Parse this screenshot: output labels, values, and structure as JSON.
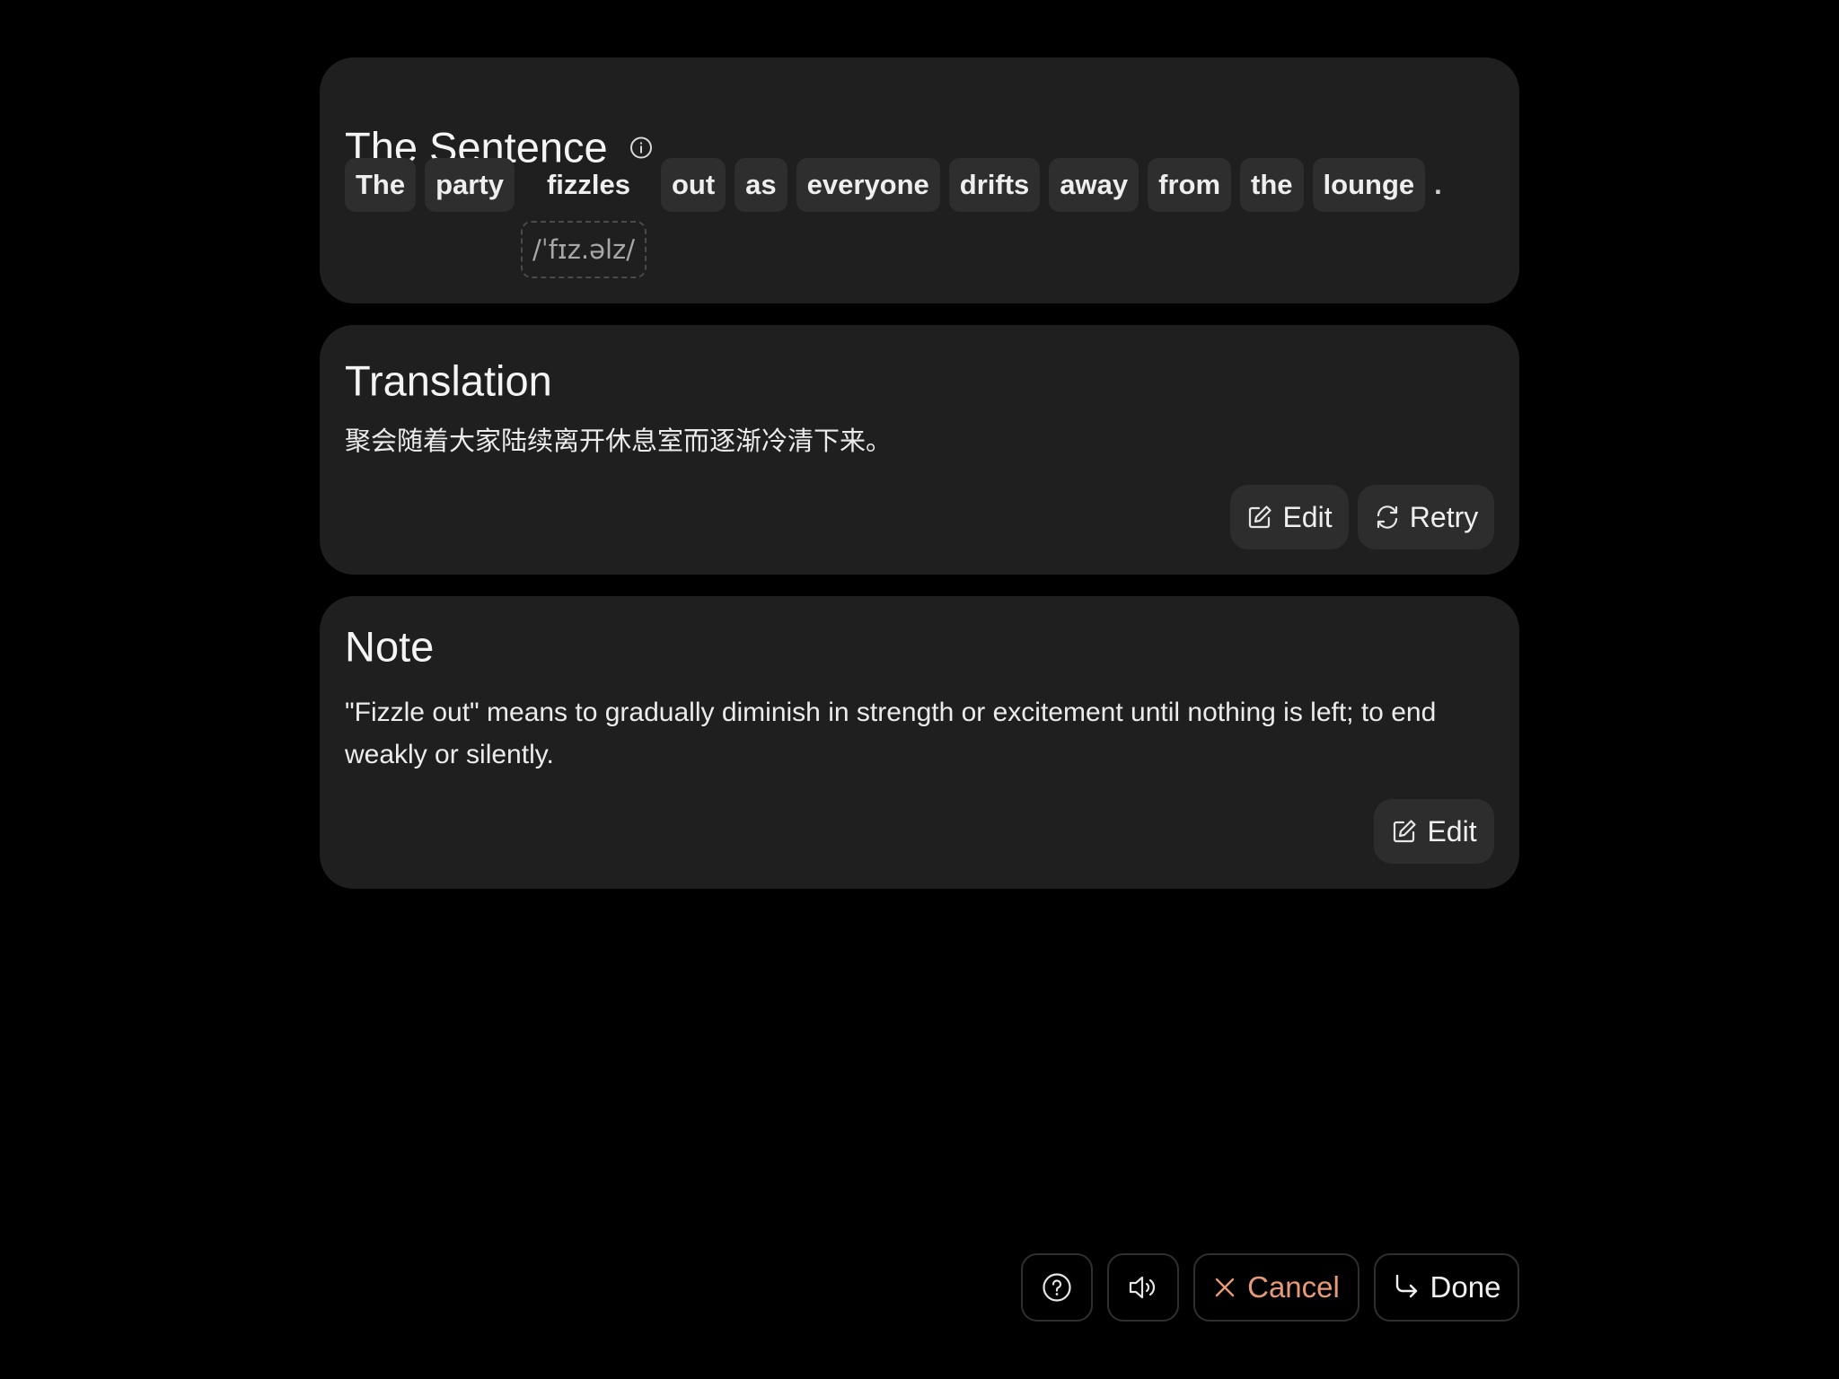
{
  "sentence_card": {
    "title": "The Sentence",
    "info_icon": "info-icon",
    "words": [
      "The",
      "party",
      "fizzles",
      "out",
      "as",
      "everyone",
      "drifts",
      "away",
      "from",
      "the",
      "lounge"
    ],
    "punctuation": ".",
    "selected_word": "fizzles",
    "phonetic": "/ˈfɪz.əlz/"
  },
  "translation_card": {
    "title": "Translation",
    "text": "聚会随着大家陆续离开休息室而逐渐冷清下来。",
    "edit_label": "Edit",
    "retry_label": "Retry"
  },
  "note_card": {
    "title": "Note",
    "text": "\"Fizzle out\" means to gradually diminish in strength or excitement until nothing is left; to end weakly or silently.",
    "edit_label": "Edit"
  },
  "toolbar": {
    "help_icon": "question-circle-icon",
    "audio_icon": "speaker-icon",
    "cancel_label": "Cancel",
    "done_label": "Done"
  },
  "colors": {
    "background": "#000000",
    "card": "#1f1f1f",
    "chip": "#2e2e2e",
    "accent_cancel": "#e89a78"
  }
}
